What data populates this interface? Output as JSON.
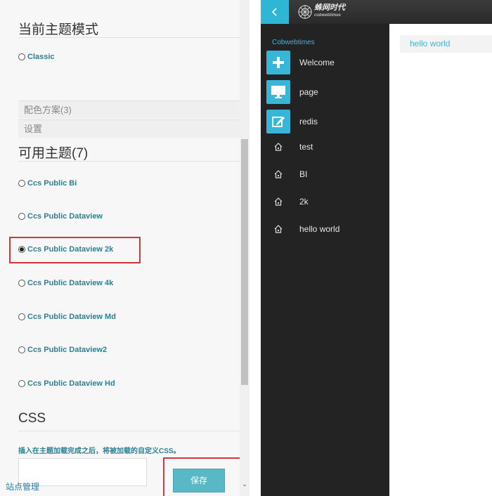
{
  "left_panel": {
    "current_theme_title": "当前主题模式",
    "current_theme_option": "Classic",
    "color_scheme_bar": "配色方案(3)",
    "settings_bar": "设置",
    "available_themes_title": "可用主题(7)",
    "themes": [
      "Ccs Public Bi",
      "Ccs Public Dataview",
      "Ccs Public Dataview 2k",
      "Ccs Public Dataview 4k",
      "Ccs Public Dataview Md",
      "Ccs Public Dataview2",
      "Ccs Public Dataview Hd"
    ],
    "selected_theme": "Ccs Public Dataview 2k",
    "css_title": "CSS",
    "css_description": "插入在主题加载完成之后，将被加载的自定义CSS。",
    "site_admin_link": "站点管理",
    "save_label": "保存"
  },
  "app": {
    "back_icon": "chevron-left-icon",
    "logo_text": "蛛网时代",
    "logo_sub": "cobwebtimes",
    "brand": "Cobwebtimes",
    "nav": [
      {
        "label": "Welcome",
        "icon": "plus-icon"
      },
      {
        "label": "page",
        "icon": "monitor-icon"
      },
      {
        "label": "redis",
        "icon": "edit-icon"
      },
      {
        "label": "test",
        "icon": "home-icon"
      },
      {
        "label": "BI",
        "icon": "home-icon"
      },
      {
        "label": "2k",
        "icon": "home-icon"
      },
      {
        "label": "hello world",
        "icon": "home-icon"
      }
    ],
    "content_tab": "hello world"
  },
  "colors": {
    "accent_cyan": "#37b6d7",
    "sidebar_bg": "#232323",
    "highlight_red": "#d0363c",
    "theme_label": "#2e7f93",
    "save_button": "#58b8c5"
  }
}
